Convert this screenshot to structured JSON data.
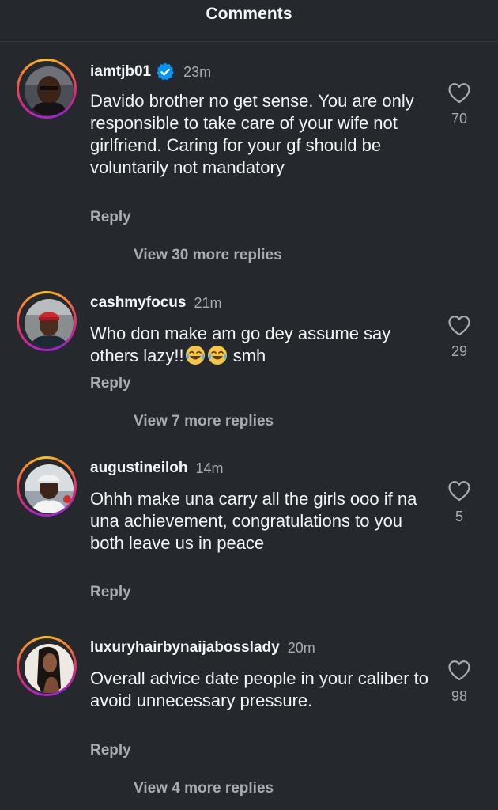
{
  "header": {
    "title": "Comments"
  },
  "comments": [
    {
      "username": "iamtjb01",
      "verified": true,
      "time": "23m",
      "text": "Davido brother no get sense.  You are only responsible to take care of your wife not girlfriend. Caring for your gf should be voluntarily not mandatory",
      "reply_label": "Reply",
      "view_more": "View 30 more replies",
      "likes": "70"
    },
    {
      "username": "cashmyfocus",
      "verified": false,
      "time": "21m",
      "text_before_emoji": "Who don make am go dey assume say others lazy!!",
      "text_after_emoji": " smh",
      "emoji_name": "face-with-tears-of-joy-icon",
      "reply_label": "Reply",
      "view_more": "View 7 more replies",
      "likes": "29"
    },
    {
      "username": "augustineiloh",
      "verified": false,
      "time": "14m",
      "text": "Ohhh make una carry all the girls ooo if na una achievement, congratulations to you both leave us in peace",
      "reply_label": "Reply",
      "likes": "5"
    },
    {
      "username": "luxuryhairbynaijabosslady",
      "verified": false,
      "time": "20m",
      "text": "Overall advice date people in your caliber to avoid unnecessary pressure.",
      "reply_label": "Reply",
      "view_more": "View 4 more replies",
      "likes": "98"
    }
  ],
  "colors": {
    "background": "#25292e",
    "text_primary": "#f3f5f7",
    "text_secondary": "#a8adb3",
    "verified_blue": "#0095f6"
  }
}
